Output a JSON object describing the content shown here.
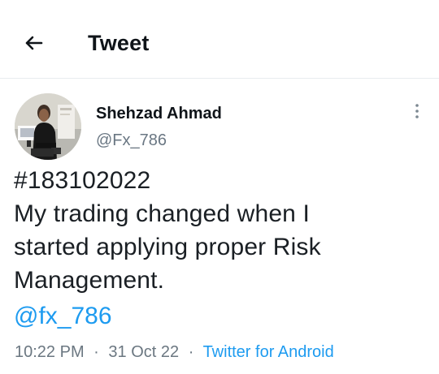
{
  "header": {
    "title": "Tweet",
    "back_icon": "arrow-left-icon"
  },
  "tweet": {
    "author": {
      "name": "Shehzad Ahmad",
      "handle": "@Fx_786"
    },
    "more_icon": "more-vertical-icon",
    "text": "#183102022\nMy trading changed when I\nstarted applying proper Risk\nManagement.",
    "mention": "@fx_786",
    "time": "10:22 PM",
    "separator_1": "·",
    "date": "31 Oct 22",
    "separator_2": "·",
    "source": "Twitter for Android"
  },
  "colors": {
    "link": "#1d9bf0",
    "muted": "#6b7781",
    "text": "#0f1419"
  }
}
